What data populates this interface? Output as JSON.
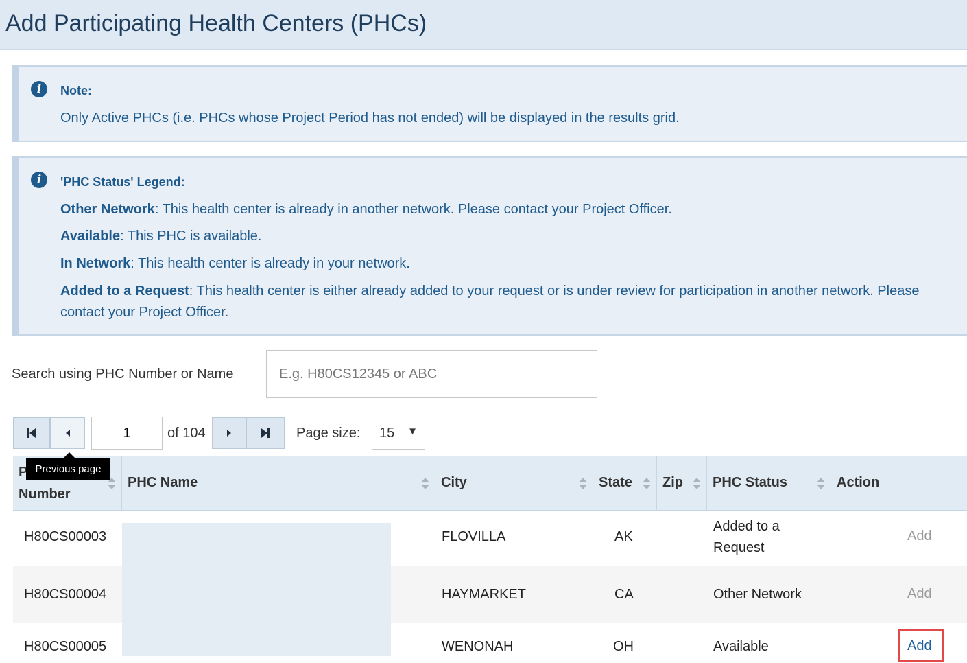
{
  "header": {
    "title": "Add Participating Health Centers (PHCs)"
  },
  "note": {
    "title": "Note:",
    "text": "Only Active PHCs (i.e. PHCs whose Project Period has not ended) will be displayed in the results grid."
  },
  "legend": {
    "title": "'PHC Status' Legend:",
    "items": [
      {
        "term": "Other Network",
        "desc": ": This health center is already in another network. Please contact your Project Officer."
      },
      {
        "term": "Available",
        "desc": ": This PHC is available."
      },
      {
        "term": "In Network",
        "desc": ": This health center is already in your network."
      },
      {
        "term": "Added to a Request",
        "desc": ": This health center is either already added to your request or is under review for participation in another network. Please contact your Project Officer."
      }
    ]
  },
  "search": {
    "label": "Search using PHC Number or Name",
    "placeholder": "E.g. H80CS12345 or ABC",
    "value": ""
  },
  "pager": {
    "current_page": "1",
    "of_text": "of 104",
    "page_size_label": "Page size:",
    "page_size": "15",
    "tooltip": "Previous page"
  },
  "table": {
    "columns": [
      "PHC Number",
      "PHC Name",
      "City",
      "State",
      "Zip",
      "PHC Status",
      "Action"
    ],
    "header_number_line1": "P",
    "header_number_line2": "Number",
    "rows": [
      {
        "number": "H80CS00003",
        "name": "",
        "city": "FLOVILLA",
        "state": "AK",
        "zip": "",
        "status_line1": "Added to a",
        "status_line2": "Request",
        "action": "Add"
      },
      {
        "number": "H80CS00004",
        "name": "",
        "city": "HAYMARKET",
        "state": "CA",
        "zip": "",
        "status_line1": "Other Network",
        "status_line2": "",
        "action": "Add"
      },
      {
        "number": "H80CS00005",
        "name": "",
        "city": "WENONAH",
        "state": "OH",
        "zip": "",
        "status_line1": "Available",
        "status_line2": "",
        "action": "Add"
      }
    ]
  },
  "colors": {
    "header_bg": "#dfe9f4",
    "info_text": "#1e5a8c",
    "link": "#1f5f9c",
    "highlight": "#e24a4a"
  }
}
